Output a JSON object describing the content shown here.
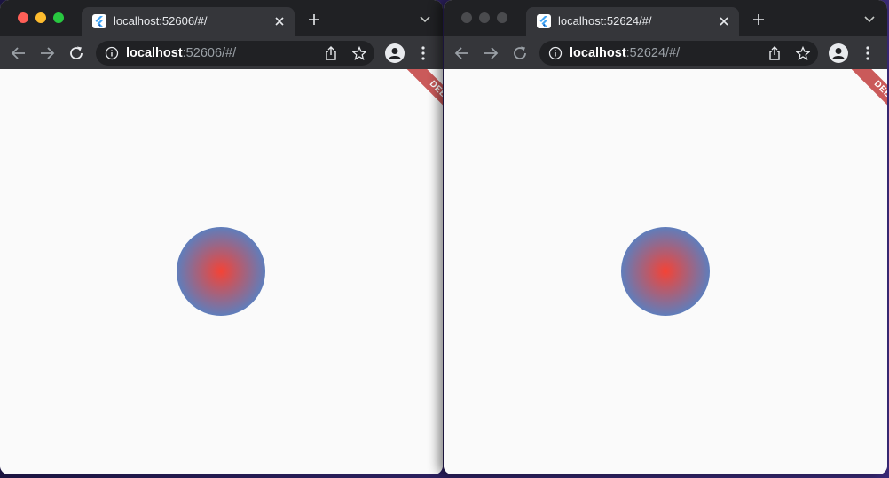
{
  "windows": [
    {
      "state": "focused",
      "tab": {
        "title": "localhost:52606/#/"
      },
      "address": {
        "host": "localhost",
        "rest": ":52606/#/"
      },
      "banner": "DEBUG"
    },
    {
      "state": "unfocused",
      "tab": {
        "title": "localhost:52624/#/"
      },
      "address": {
        "host": "localhost",
        "rest": ":52624/#/"
      },
      "banner": "DEBUG"
    }
  ],
  "colors": {
    "gradient_center": "#f44336",
    "gradient_edge": "#2196f3",
    "debug_banner": "#b71c1c"
  },
  "icons": [
    "flutter-logo-icon",
    "close-icon",
    "plus-icon",
    "chevron-down-icon",
    "back-arrow-icon",
    "forward-arrow-icon",
    "reload-icon",
    "info-icon",
    "share-icon",
    "star-icon",
    "profile-icon",
    "more-vertical-icon"
  ]
}
